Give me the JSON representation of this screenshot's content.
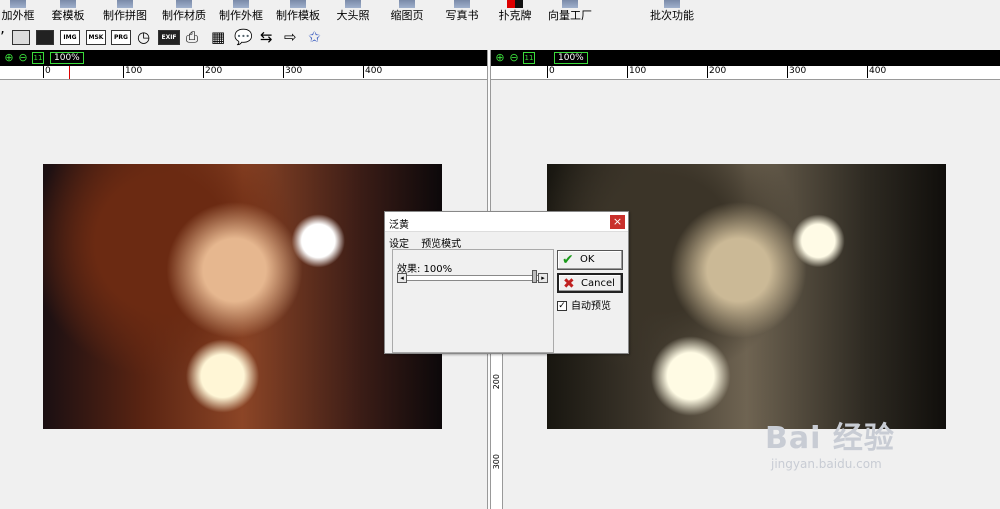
{
  "menu": {
    "items": [
      "加外框",
      "套模板",
      "制作拼图",
      "制作材质",
      "制作外框",
      "制作模板",
      "大头照",
      "缩图页",
      "写真书",
      "扑克牌",
      "向量工厂",
      "批次功能"
    ]
  },
  "toolbar": {
    "buttons": [
      "IMG",
      "MSK",
      "PRG",
      "EXIF"
    ]
  },
  "viewer": {
    "zoom_left": "100%",
    "zoom_right": "100%",
    "ruler_ticks": [
      "0",
      "100",
      "200",
      "300",
      "400"
    ],
    "vruler_ticks": [
      "200",
      "300"
    ]
  },
  "dialog": {
    "title": "泛黄",
    "close": "×",
    "menu": [
      "设定",
      "预览模式"
    ],
    "effect_label": "效果: 100%",
    "effect_value": 100,
    "ok_label": "OK",
    "cancel_label": "Cancel",
    "auto_preview_label": "自动预览",
    "auto_preview_checked": true
  },
  "watermark": {
    "text": "Bai 经验",
    "url": "jingyan.baidu.com"
  },
  "icons": {
    "zoom_in": "zoom-in-icon",
    "zoom_out": "zoom-out-icon",
    "fit": "fit-icon",
    "ok": "check-icon",
    "cancel": "x-icon"
  }
}
